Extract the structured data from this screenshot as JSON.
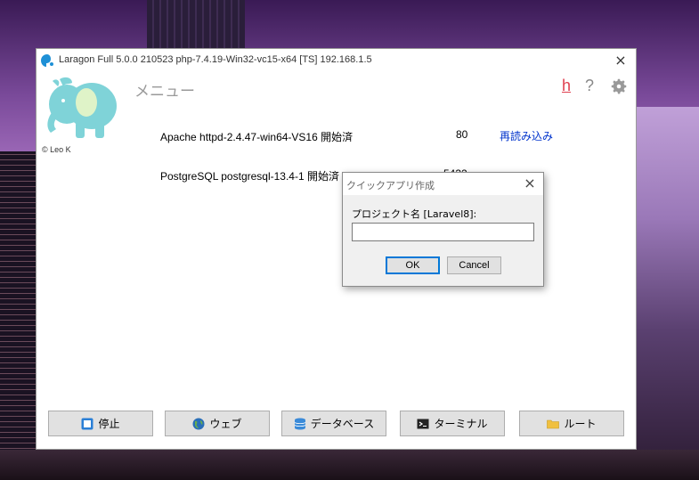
{
  "window": {
    "title": "Laragon Full 5.0.0 210523 php-7.4.19-Win32-vc15-x64 [TS]  192.168.1.5",
    "close_icon": "×"
  },
  "header": {
    "menu_title": "メニュー",
    "credit": "© Leo K",
    "h_icon": "h",
    "help_icon": "?"
  },
  "services": [
    {
      "name": "Apache httpd-2.4.47-win64-VS16 開始済",
      "port": "80",
      "action": "再読み込み"
    },
    {
      "name": "PostgreSQL postgresql-13.4-1 開始済",
      "port": "5432"
    }
  ],
  "buttons": {
    "stop": "停止",
    "web": "ウェブ",
    "database": "データベース",
    "terminal": "ターミナル",
    "root": "ルート"
  },
  "dialog": {
    "title": "クイックアプリ作成",
    "label": "プロジェクト名 [Laravel8]:",
    "input_value": "",
    "ok": "OK",
    "cancel": "Cancel",
    "close_icon": "×"
  },
  "colors": {
    "accent": "#0078d7",
    "link": "#0033cc",
    "h_icon": "#e04050",
    "logo": "#7fd3d8"
  }
}
